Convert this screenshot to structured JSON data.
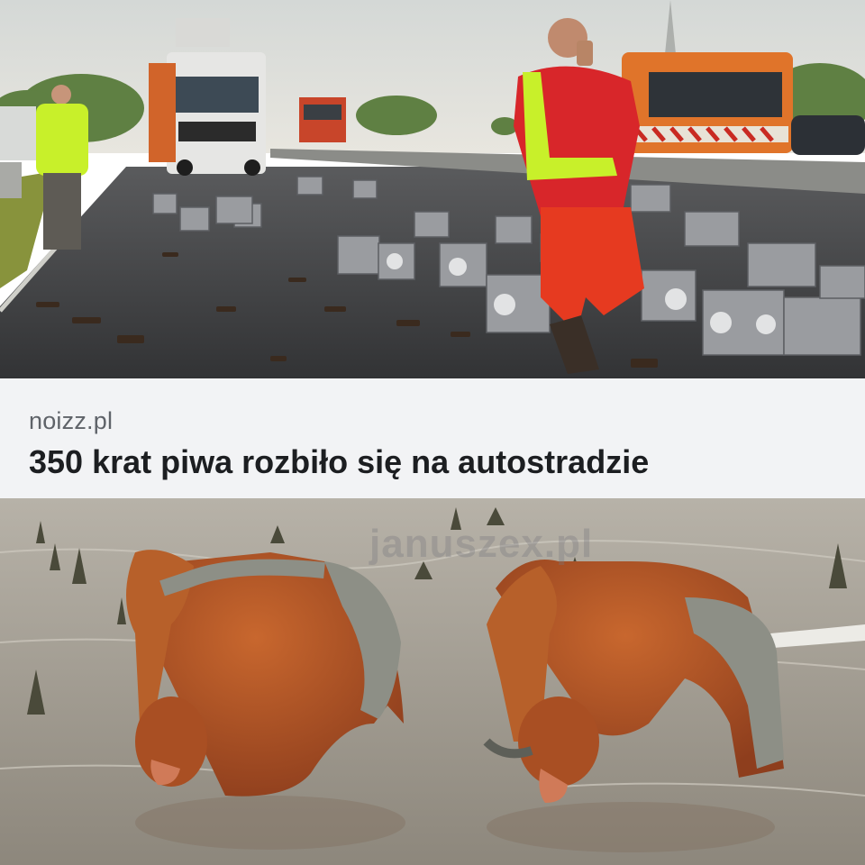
{
  "post": {
    "source": "noizz.pl",
    "headline": "350 krat piwa rozbiło się na autostradzie",
    "watermark": "januszex.pl"
  },
  "top_image": {
    "subject": "highway-beer-crates",
    "colors": {
      "sky": "#d9dcd8",
      "road": "#3d3e40",
      "vest": "#c8f02a",
      "shirt": "#d8262a",
      "truck_orange": "#e8711f"
    }
  },
  "bottom_image": {
    "subject": "proboscis-monkeys-drinking",
    "colors": {
      "water": "#a7a196",
      "fur": "#b5582a",
      "arm": "#8d8f86"
    }
  },
  "colors": {
    "caption_bg": "#f2f3f5",
    "source_text": "#5f6369",
    "headline_text": "#1c1e21"
  }
}
